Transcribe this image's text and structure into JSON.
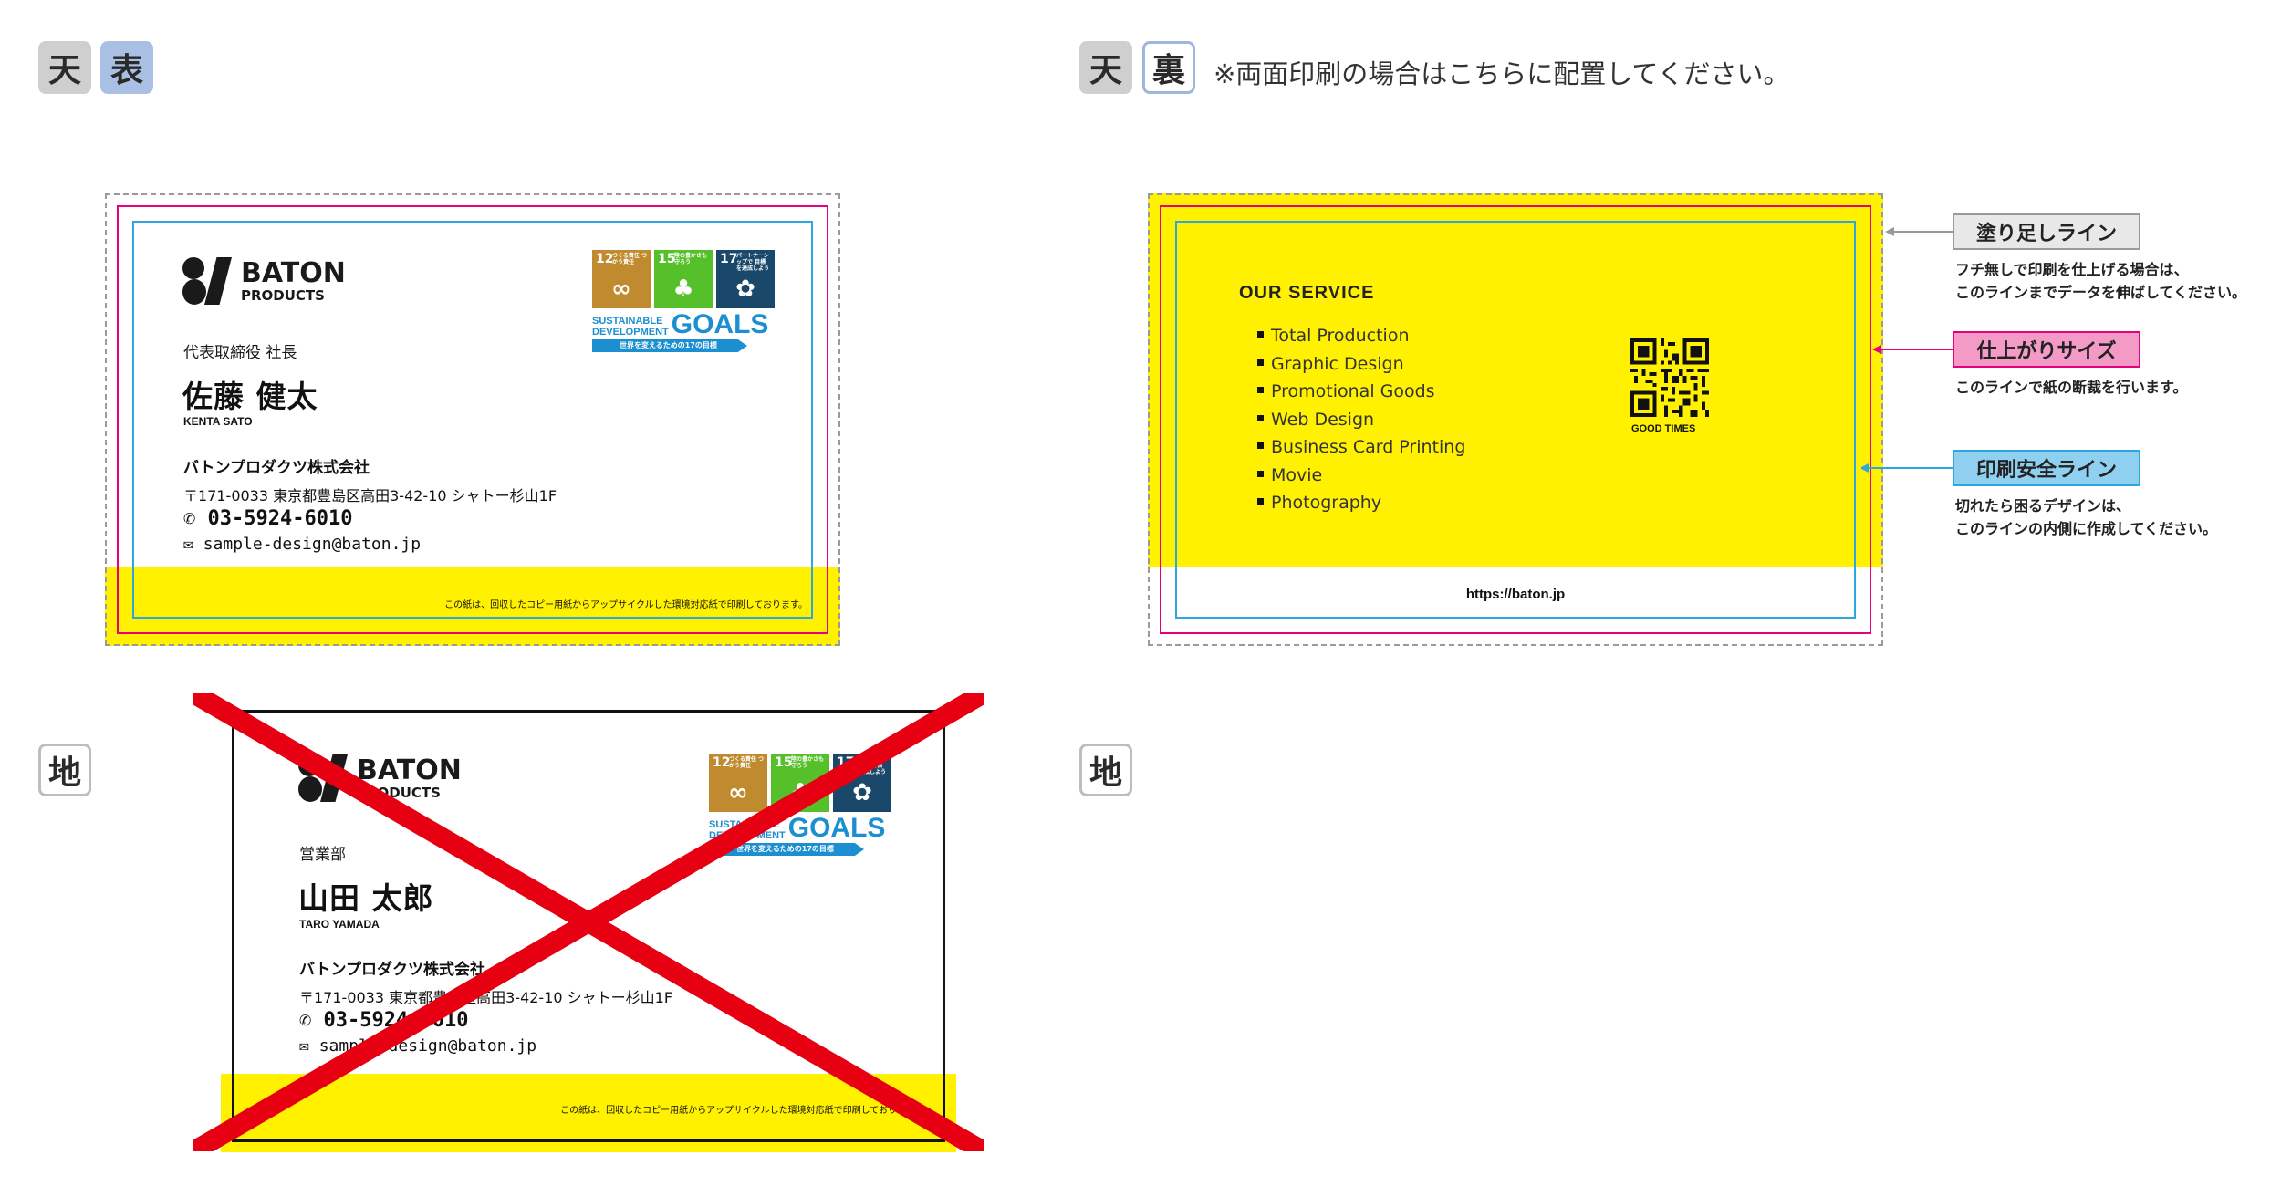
{
  "labels": {
    "top_front": "天",
    "front": "表",
    "top_back": "天",
    "back": "裏",
    "back_note": "※両面印刷の場合はこちらに配置してください。",
    "bottom_left": "地",
    "bottom_right": "地"
  },
  "logo": {
    "line1": "BATON",
    "line2": "PRODUCTS"
  },
  "sdgs": {
    "tiles": [
      {
        "num": "12",
        "text": "つくる責任 つかう責任",
        "color": "#bf8b2e",
        "icon": "infinity-icon"
      },
      {
        "num": "15",
        "text": "陸の豊かさも 守ろう",
        "color": "#56c02b",
        "icon": "tree-icon"
      },
      {
        "num": "17",
        "text": "パートナーシップで 目標を達成しよう",
        "color": "#19486a",
        "icon": "flower-icon"
      }
    ],
    "sd_line1": "SUSTAINABLE",
    "sd_line2": "DEVELOPMENT",
    "goals": "GOALS",
    "bar_text": "世界を変えるための17の目標"
  },
  "card_correct": {
    "title": "代表取締役 社長",
    "name": "佐藤 健太",
    "romaji": "KENTA SATO",
    "company": "バトンプロダクツ株式会社",
    "address": "〒171-0033 東京都豊島区高田3-42-10 シャトー杉山1F",
    "tel": "03-5924-6010",
    "email": "sample-design@baton.jp",
    "paper_note": "この紙は、回収したコピー用紙からアップサイクルした環境対応紙で印刷しております。"
  },
  "card_wrong": {
    "title": "営業部",
    "name": "山田 太郎",
    "romaji": "TARO YAMADA",
    "company": "バトンプロダクツ株式会社",
    "address": "〒171-0033 東京都豊島区高田3-42-10 シャトー杉山1F",
    "tel": "03-5924-6010",
    "email": "sample-design@baton.jp",
    "paper_note": "この紙は、回収したコピー用紙からアップサイクルした環境対応紙で印刷しております。"
  },
  "back_card": {
    "service_title": "OUR SERVICE",
    "services": [
      "Total Production",
      "Graphic Design",
      "Promotional Goods",
      "Web Design",
      "Business Card Printing",
      "Movie",
      "Photography"
    ],
    "qr_caption": "GOOD TIMES",
    "url": "https://baton.jp"
  },
  "legend": {
    "bleed": {
      "label": "塗り足しライン",
      "desc1": "フチ無しで印刷を仕上げる場合は、",
      "desc2": "このラインまでデータを伸ばしてください。"
    },
    "trim": {
      "label": "仕上がりサイズ",
      "desc1": "このラインで紙の断裁を行います。"
    },
    "safe": {
      "label": "印刷安全ライン",
      "desc1": "切れたら困るデザインは、",
      "desc2": "このラインの内側に作成してください。"
    }
  },
  "colors": {
    "yellow": "#fff100",
    "trim_magenta": "#e4007f",
    "safe_cyan": "#2ea7e0",
    "cross_red": "#e60012"
  }
}
